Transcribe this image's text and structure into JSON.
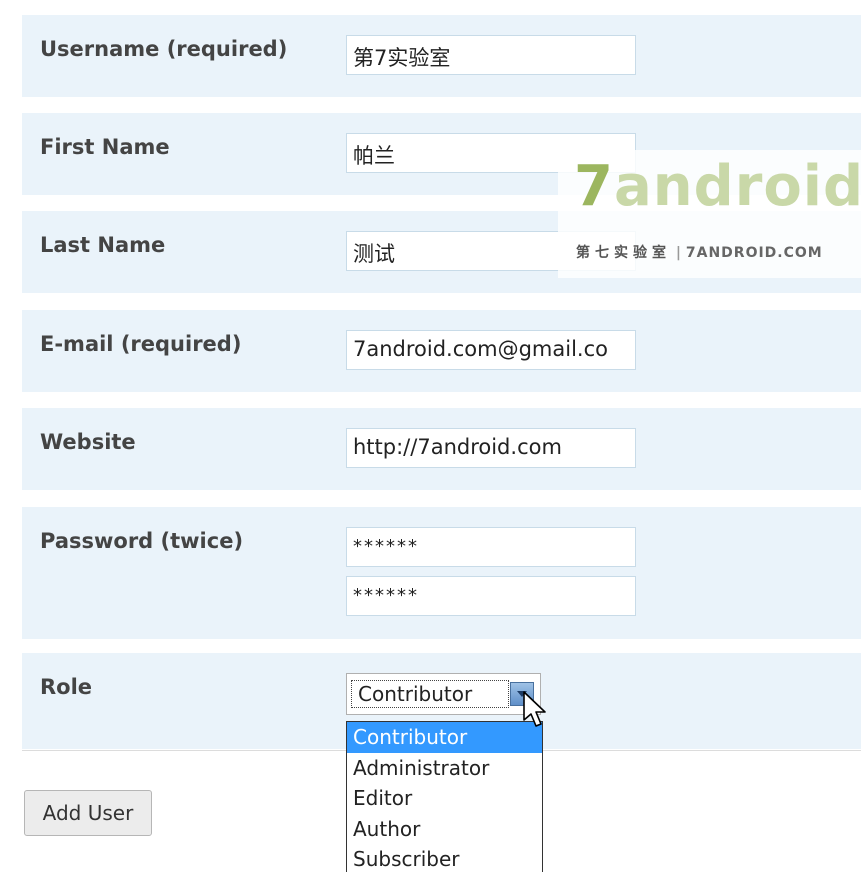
{
  "form": {
    "username": {
      "label": "Username (required)",
      "value": "第7实验室"
    },
    "first_name": {
      "label": "First Name",
      "value": "帕兰"
    },
    "last_name": {
      "label": "Last Name",
      "value": "测试"
    },
    "email": {
      "label": "E-mail (required)",
      "value": "7android.com@gmail.co"
    },
    "website": {
      "label": "Website",
      "value": "http://7android.com"
    },
    "password": {
      "label": "Password (twice)",
      "value1": "******",
      "value2": "******"
    },
    "role": {
      "label": "Role",
      "selected": "Contributor",
      "options": [
        "Contributor",
        "Administrator",
        "Editor",
        "Author",
        "Subscriber"
      ]
    }
  },
  "add_user_button": "Add User",
  "watermark": {
    "logo_seven": "7",
    "logo_rest": "android",
    "sub_cn": "第七实验室",
    "sub_en": "7ANDROID.COM"
  }
}
